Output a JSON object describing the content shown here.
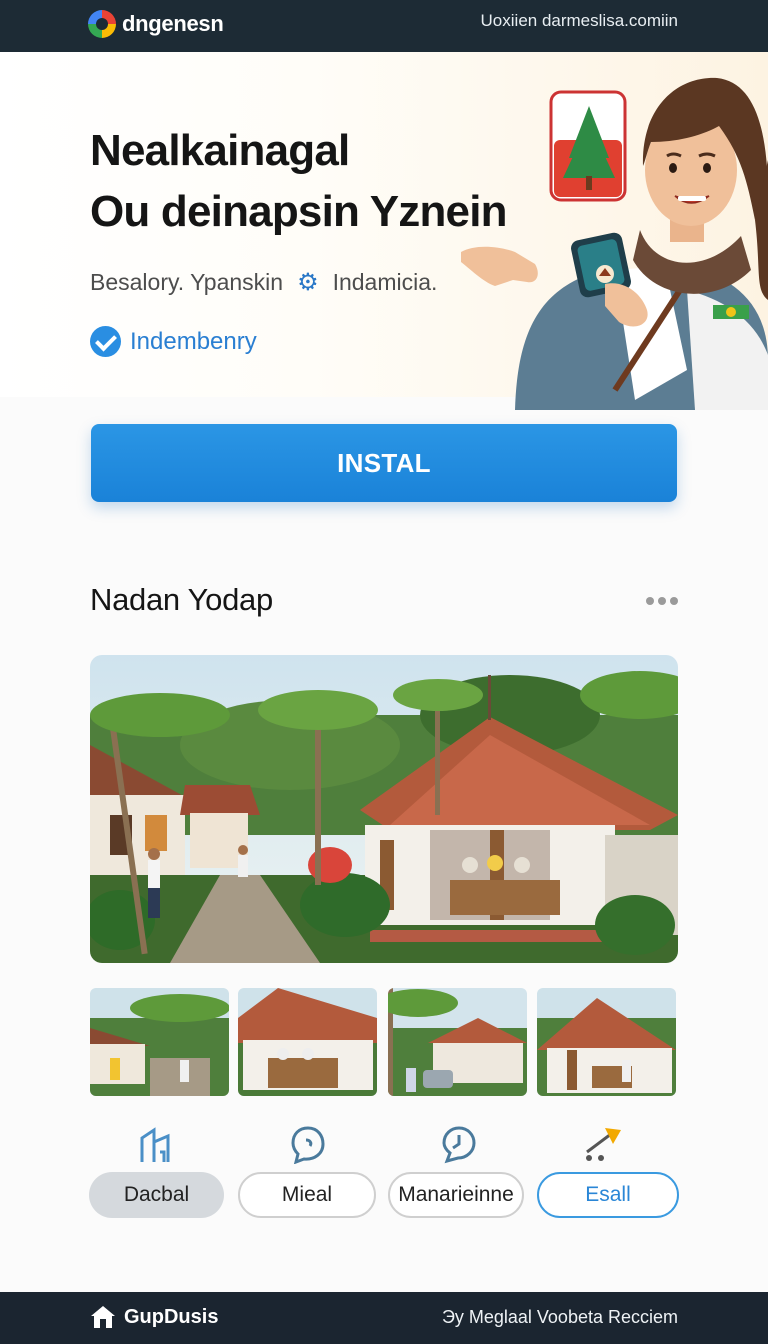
{
  "topbar": {
    "brand": "dngenesn",
    "url": "Uoxiien darmeslisa.comiin"
  },
  "hero": {
    "title_line1": "Nealkainagal",
    "title_line2": "Ou deinapsin Yznein",
    "meta_left": "Besalory. Ypanskin",
    "meta_right": "Indamicia.",
    "verified_label": "Indembenry"
  },
  "install_label": "INSTAL",
  "section": {
    "title": "Nadan Yodap"
  },
  "categories": [
    {
      "label": "Dacbal",
      "icon": "building-icon",
      "selected": true
    },
    {
      "label": "Mieal",
      "icon": "chat-bubble-icon",
      "selected": false
    },
    {
      "label": "Manarieinne",
      "icon": "clock-bubble-icon",
      "selected": false
    },
    {
      "label": "Esall",
      "icon": "send-arrow-icon",
      "selected": false
    }
  ],
  "footer": {
    "brand": "GupDusis",
    "credit": "Эy Meglaal Voobeta Recciem"
  },
  "colors": {
    "accent": "#1a82d8",
    "topbar": "#1d2b35",
    "footer": "#1b2530"
  }
}
